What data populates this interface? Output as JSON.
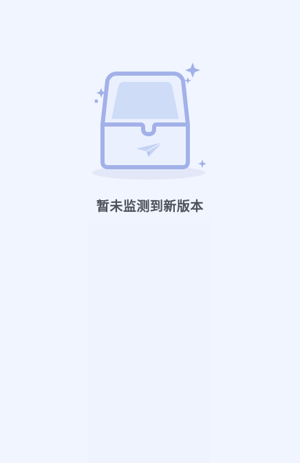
{
  "empty_state": {
    "message": "暂未监测到新版本",
    "illustration_icon": "empty-inbox-icon",
    "colors": {
      "background": "#f0f5ff",
      "illustration_stroke": "#a3b1e9",
      "illustration_fill": "#cfdcf8",
      "text": "#4d5059"
    }
  }
}
